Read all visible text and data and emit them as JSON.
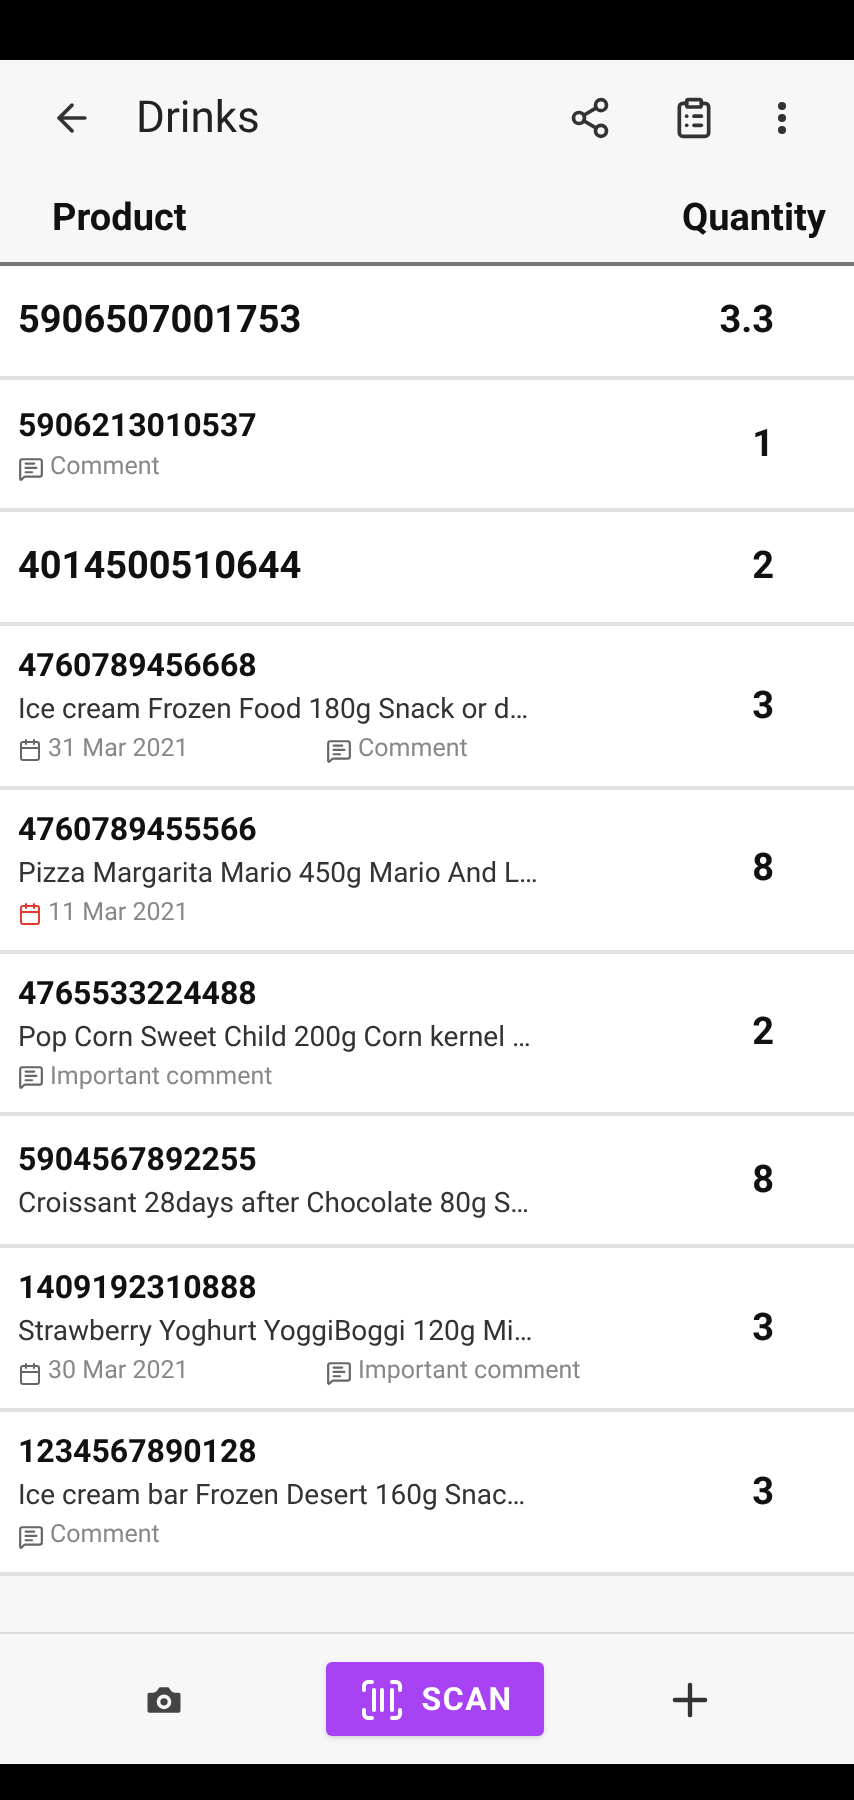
{
  "header": {
    "title": "Drinks"
  },
  "columns": [
    "Product",
    "Quantity"
  ],
  "rows": [
    {
      "code": "5906507001753",
      "quantity": "3.3",
      "large": true
    },
    {
      "code": "5906213010537",
      "quantity": "1",
      "comment": "Comment"
    },
    {
      "code": "4014500510644",
      "quantity": "2",
      "large": true
    },
    {
      "code": "4760789456668",
      "name": "Ice cream Frozen Food 180g Snack or d…",
      "date": "31 Mar 2021",
      "expired": false,
      "comment": "Comment",
      "quantity": "3"
    },
    {
      "code": "4760789455566",
      "name": "Pizza Margarita Mario 450g Mario And L…",
      "date": "11 Mar 2021",
      "expired": true,
      "quantity": "8"
    },
    {
      "code": "4765533224488",
      "name": "Pop Corn Sweet Child 200g Corn kernel …",
      "comment": "Important comment",
      "quantity": "2"
    },
    {
      "code": "5904567892255",
      "name": "Croissant 28days after Chocolate 80g S…",
      "quantity": "8"
    },
    {
      "code": "1409192310888",
      "name": "Strawberry Yoghurt YoggiBoggi 120g Mi…",
      "date": "30 Mar 2021",
      "expired": false,
      "comment": "Important comment",
      "quantity": "3"
    },
    {
      "code": "1234567890128",
      "name": "Ice cream bar Frozen Desert 160g Snac…",
      "comment": "Comment",
      "quantity": "3"
    }
  ],
  "scan_button": {
    "label": "SCAN"
  }
}
